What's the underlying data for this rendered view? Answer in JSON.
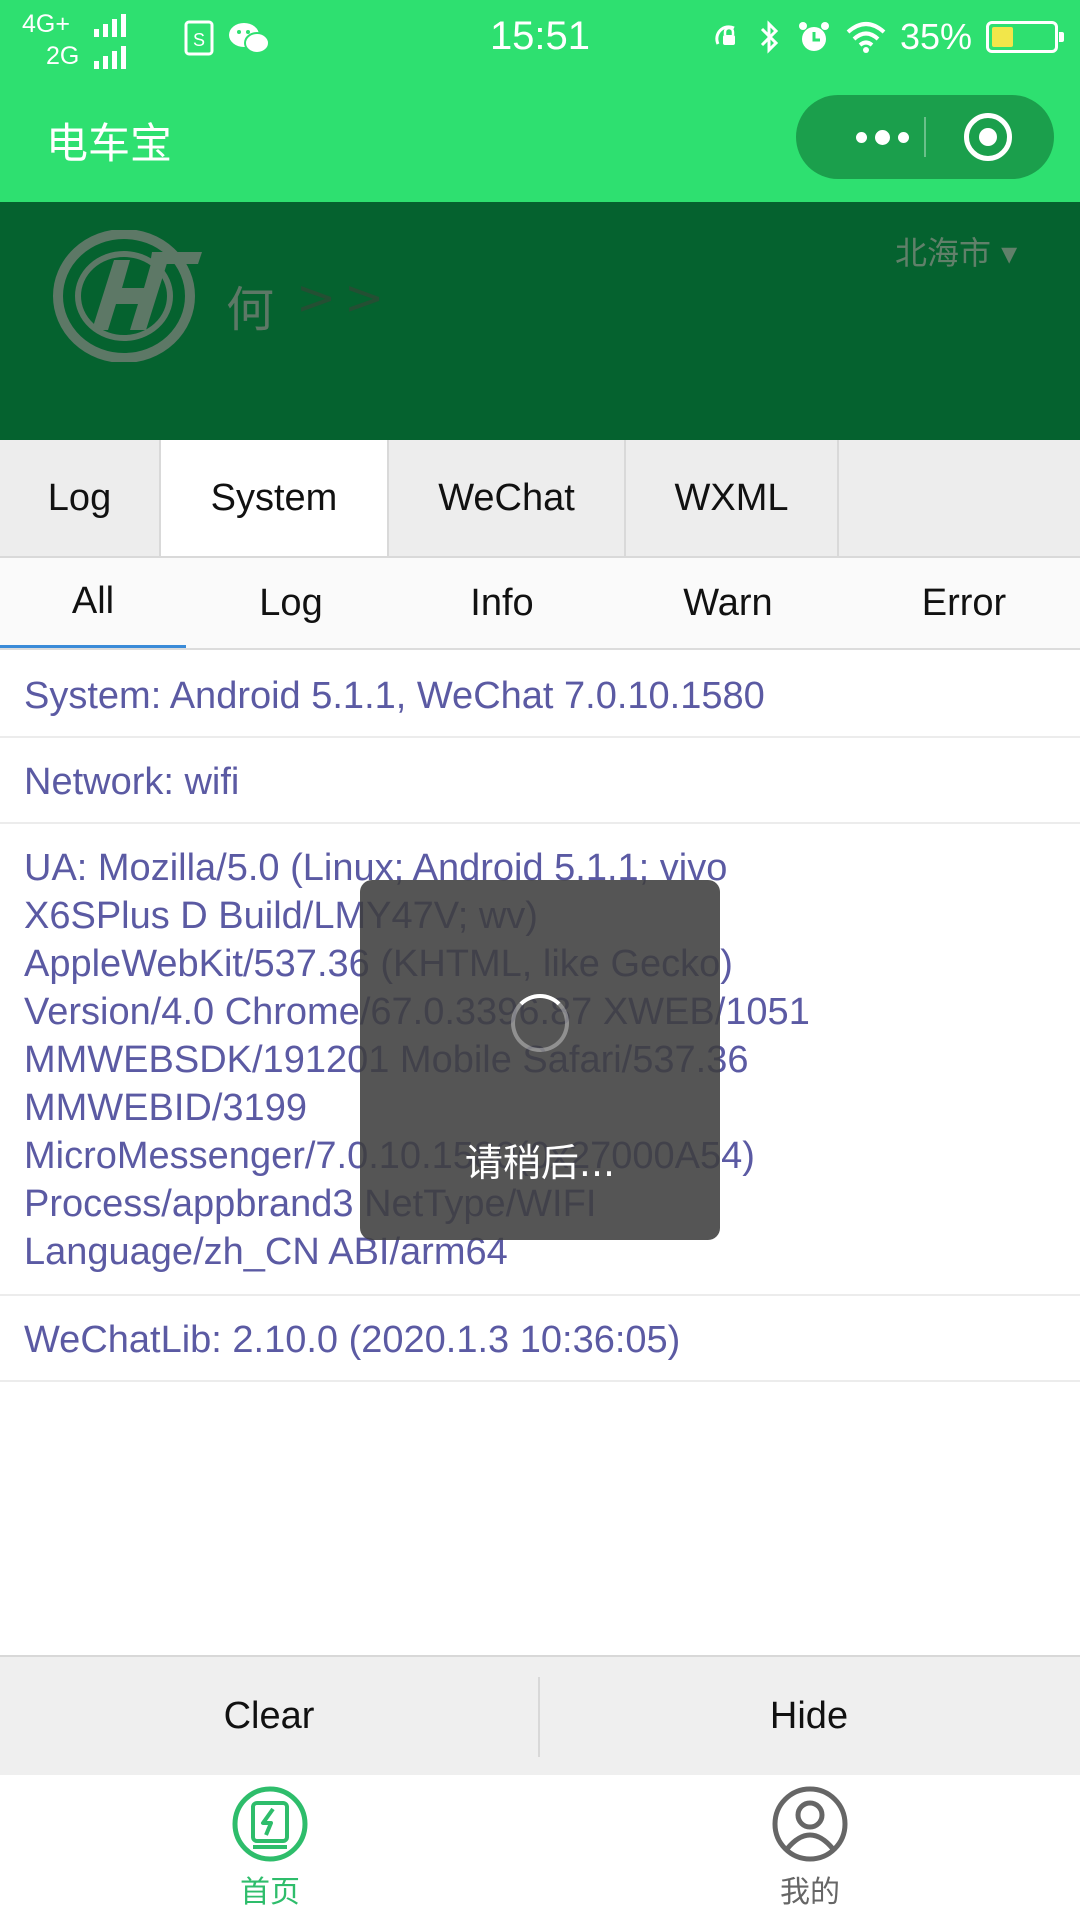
{
  "status_bar": {
    "network_1": "4G+",
    "network_2": "2G",
    "time": "15:51",
    "battery": "35%",
    "battery_level": 0.35,
    "icons": [
      "sim-card-icon",
      "wechat-icon",
      "rotation-lock-icon",
      "bluetooth-icon",
      "alarm-icon",
      "wifi-icon",
      "battery-charging-icon"
    ]
  },
  "app": {
    "title": "电车宝",
    "capsule": {
      "more": "more-icon",
      "close": "close-target-icon"
    }
  },
  "header": {
    "user_name": "何",
    "chevrons": [
      ">",
      ">"
    ],
    "city": "北海市 ▾"
  },
  "console": {
    "tabs": [
      {
        "label": "Log"
      },
      {
        "label": "System",
        "active": true
      },
      {
        "label": "WeChat"
      },
      {
        "label": "WXML"
      }
    ],
    "filters": [
      {
        "label": "All",
        "active": true
      },
      {
        "label": "Log"
      },
      {
        "label": "Info"
      },
      {
        "label": "Warn"
      },
      {
        "label": "Error"
      }
    ],
    "logs": {
      "system": "System: Android 5.1.1, WeChat 7.0.10.1580",
      "network": "Network: wifi",
      "ua_lines": [
        "UA: Mozilla/5.0 (Linux; Android 5.1.1; vivo",
        "X6SPlus D Build/LMY47V; wv)",
        "AppleWebKit/537.36 (KHTML, like Gecko)",
        "Version/4.0 Chrome/67.0.3396.87 XWEB/1051",
        "MMWEBSDK/191201 Mobile Safari/537.36",
        "MMWEBID/3199",
        "MicroMessenger/7.0.10.1580(0x27000A54)",
        "Process/appbrand3 NetType/WIFI",
        "Language/zh_CN ABI/arm64"
      ],
      "wechat_lib": "WeChatLib: 2.10.0 (2020.1.3 10:36:05)"
    },
    "actions": {
      "clear": "Clear",
      "hide": "Hide"
    }
  },
  "toast": {
    "text": "请稍后..."
  },
  "tabbar": {
    "home": "首页",
    "mine": "我的"
  },
  "colors": {
    "title_bar": "#2ee070",
    "banner": "#05622f",
    "log_text": "#5b5aa3",
    "active_tab_underline": "#3a8bd8",
    "tabbar_active": "#2ebd6b",
    "tabbar_inactive": "#666666"
  }
}
